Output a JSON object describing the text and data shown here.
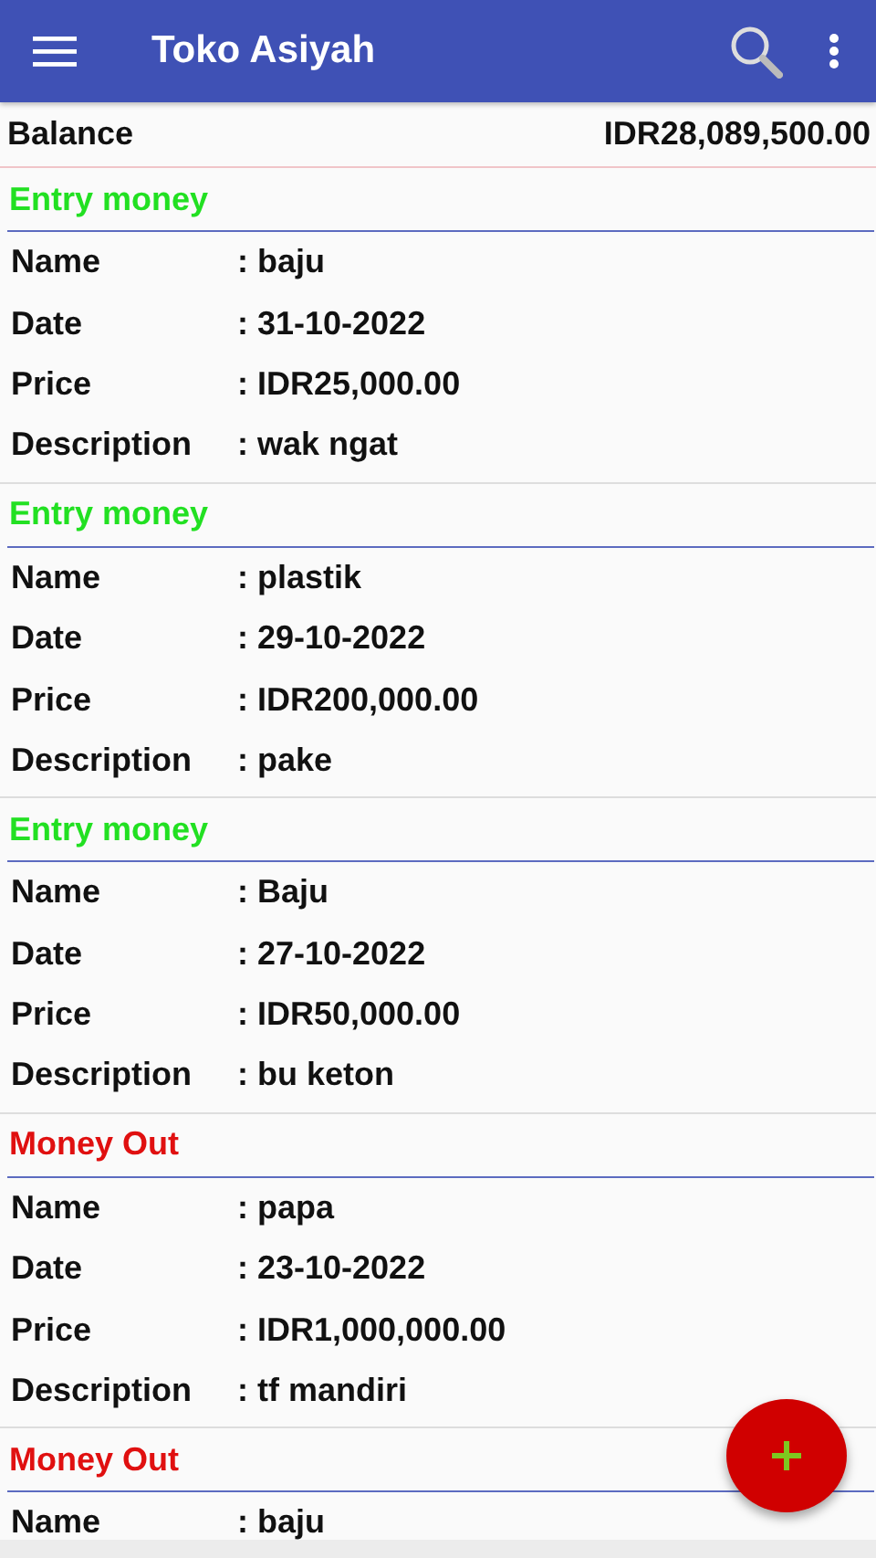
{
  "app_bar": {
    "title": "Toko Asiyah"
  },
  "balance": {
    "label": "Balance",
    "amount": "IDR28,089,500.00"
  },
  "entries": [
    {
      "kind": "in",
      "heading": "Entry money",
      "fields": [
        {
          "label": "Name",
          "separator": ":",
          "value": "baju"
        },
        {
          "label": "Date",
          "separator": ":",
          "value": "31-10-2022"
        },
        {
          "label": "Price",
          "separator": ":",
          "value": "IDR25,000.00"
        },
        {
          "label": "Description",
          "separator": ":",
          "value": "wak ngat"
        }
      ]
    },
    {
      "kind": "in",
      "heading": "Entry money",
      "fields": [
        {
          "label": "Name",
          "separator": ":",
          "value": "plastik"
        },
        {
          "label": "Date",
          "separator": ":",
          "value": "29-10-2022"
        },
        {
          "label": "Price",
          "separator": ":",
          "value": "IDR200,000.00"
        },
        {
          "label": "Description",
          "separator": ":",
          "value": "pake"
        }
      ]
    },
    {
      "kind": "in",
      "heading": "Entry money",
      "fields": [
        {
          "label": "Name",
          "separator": ":",
          "value": "Baju"
        },
        {
          "label": "Date",
          "separator": ":",
          "value": "27-10-2022"
        },
        {
          "label": "Price",
          "separator": ":",
          "value": "IDR50,000.00"
        },
        {
          "label": "Description",
          "separator": ":",
          "value": "bu keton"
        }
      ]
    },
    {
      "kind": "out",
      "heading": "Money Out",
      "fields": [
        {
          "label": "Name",
          "separator": ":",
          "value": "papa"
        },
        {
          "label": "Date",
          "separator": ":",
          "value": "23-10-2022"
        },
        {
          "label": "Price",
          "separator": ":",
          "value": "IDR1,000,000.00"
        },
        {
          "label": "Description",
          "separator": ":",
          "value": "tf mandiri"
        }
      ]
    },
    {
      "kind": "out",
      "heading": "Money Out",
      "fields": [
        {
          "label": "Name",
          "separator": ":",
          "value": "baju"
        }
      ]
    }
  ]
}
